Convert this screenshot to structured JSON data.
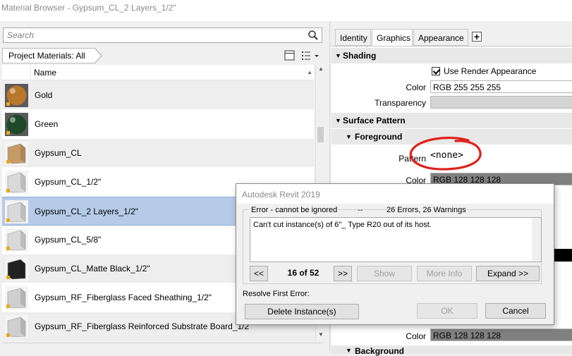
{
  "window": {
    "title": "Material Browser - Gypsum_CL_2 Layers_1/2\""
  },
  "left": {
    "search_placeholder": "Search",
    "project_button": "Project Materials: All",
    "column_name": "Name",
    "materials": [
      {
        "name": "Gold",
        "thumb": "gold-sphere",
        "color": "#b8772a"
      },
      {
        "name": "Green",
        "thumb": "green-sphere",
        "color": "#1e4a2a"
      },
      {
        "name": "Gypsum_CL",
        "thumb": "tan-box",
        "color": "#c69a64"
      },
      {
        "name": "Gypsum_CL_1/2\"",
        "thumb": "white-box",
        "color": "#d9d9d9"
      },
      {
        "name": "Gypsum_CL_2 Layers_1/2\"",
        "thumb": "white-box",
        "color": "#d9d9d9",
        "selected": true
      },
      {
        "name": "Gypsum_CL_5/8\"",
        "thumb": "white-box",
        "color": "#d9d9d9"
      },
      {
        "name": "Gypsum_CL_Matte Black_1/2\"",
        "thumb": "black-box",
        "color": "#222222"
      },
      {
        "name": "Gypsum_RF_Fiberglass Faced Sheathing_1/2\"",
        "thumb": "white-box",
        "color": "#cfcfcf"
      },
      {
        "name": "Gypsum_RF_Fiberglass Reinforced Substrate Board_1/2\"",
        "thumb": "white-box",
        "color": "#cfcfcf"
      }
    ]
  },
  "right": {
    "tabs": [
      {
        "label": "Identity",
        "active": false
      },
      {
        "label": "Graphics",
        "active": true
      },
      {
        "label": "Appearance",
        "active": false
      }
    ],
    "plus_label": "+",
    "shading": {
      "header": "Shading",
      "use_render_label": "Use Render Appearance",
      "color_label": "Color",
      "color_value": "RGB 255 255 255",
      "transparency_label": "Transparency"
    },
    "surface_pattern": {
      "header": "Surface Pattern",
      "foreground_header": "Foreground",
      "pattern_label": "Pattern",
      "pattern_value": "<none>",
      "color_label": "Color",
      "color_value": "RGB 128 128 128"
    },
    "lower": {
      "color_label": "Color",
      "color_value": "RGB 128 128 128",
      "background_header": "Background"
    }
  },
  "dialog": {
    "title": "Autodesk Revit 2019",
    "error_type": "Error - cannot be ignored",
    "separator": "--",
    "counts": "26 Errors, 26 Warnings",
    "message": "Can't cut instance(s) of 6\"_ Type R20 out of its host.",
    "prev_label": "<<",
    "position": "16 of 52",
    "next_label": ">>",
    "show_label": "Show",
    "more_info_label": "More Info",
    "expand_label": "Expand >>",
    "resolve_label": "Resolve First Error:",
    "delete_label": "Delete Instance(s)",
    "ok_label": "OK",
    "cancel_label": "Cancel"
  },
  "colors": {
    "selection": "#b6cbe8",
    "annotation": "#e0201c"
  }
}
